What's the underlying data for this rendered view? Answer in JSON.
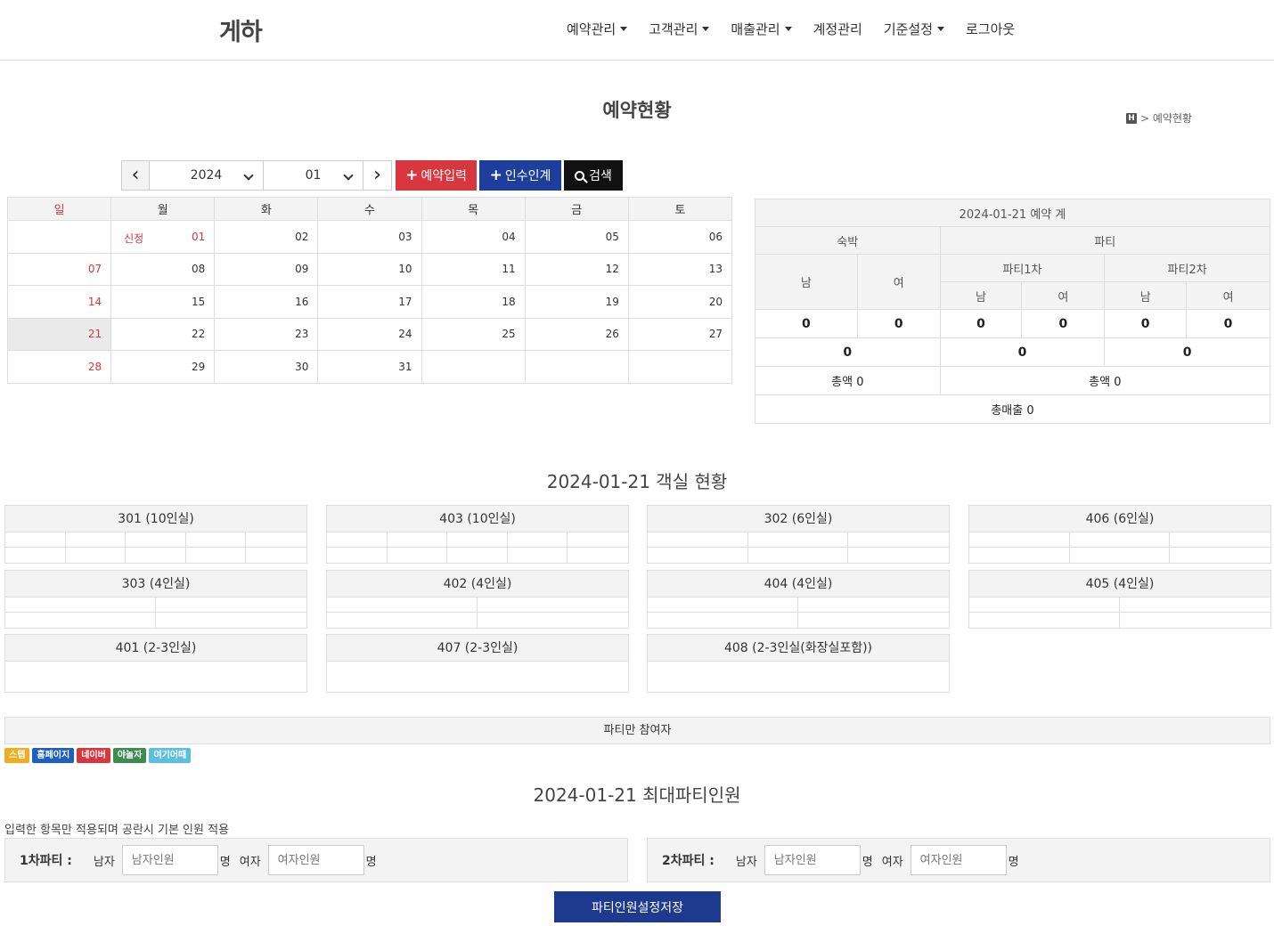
{
  "header": {
    "logo": "게하",
    "nav": [
      {
        "label": "예약관리",
        "dropdown": true
      },
      {
        "label": "고객관리",
        "dropdown": true
      },
      {
        "label": "매출관리",
        "dropdown": true
      },
      {
        "label": "계정관리",
        "dropdown": false
      },
      {
        "label": "기준설정",
        "dropdown": true
      },
      {
        "label": "로그아웃",
        "dropdown": false
      }
    ]
  },
  "page": {
    "title": "예약현황",
    "breadcrumb_home": "H",
    "breadcrumb_sep": ">",
    "breadcrumb_current": "예약현황"
  },
  "controls": {
    "year": "2024",
    "month": "01",
    "prev": "‹",
    "next": "›",
    "add_reservation": "예약입력",
    "handover": "인수인계",
    "search": "검색"
  },
  "calendar": {
    "weekdays": [
      "일",
      "월",
      "화",
      "수",
      "목",
      "금",
      "토"
    ],
    "holiday_label": "신정",
    "weeks": [
      [
        "",
        "01",
        "02",
        "03",
        "04",
        "05",
        "06"
      ],
      [
        "07",
        "08",
        "09",
        "10",
        "11",
        "12",
        "13"
      ],
      [
        "14",
        "15",
        "16",
        "17",
        "18",
        "19",
        "20"
      ],
      [
        "21",
        "22",
        "23",
        "24",
        "25",
        "26",
        "27"
      ],
      [
        "28",
        "29",
        "30",
        "31",
        "",
        "",
        ""
      ]
    ]
  },
  "summary": {
    "title": "2024-01-21 예약 계",
    "stay": "숙박",
    "party": "파티",
    "party1": "파티1차",
    "party2": "파티2차",
    "male": "남",
    "female": "여",
    "stay_m": "0",
    "stay_f": "0",
    "p1_m": "0",
    "p1_f": "0",
    "p2_m": "0",
    "p2_f": "0",
    "stay_total": "0",
    "p1_total": "0",
    "p2_total": "0",
    "stay_amount": "총액 0",
    "party_amount": "총액 0",
    "total_sales": "총매출 0"
  },
  "rooms": {
    "title": "2024-01-21 객실 현황",
    "list": [
      {
        "name": "301 (10인실)"
      },
      {
        "name": "403 (10인실)"
      },
      {
        "name": "302 (6인실)"
      },
      {
        "name": "406 (6인실)"
      },
      {
        "name": "303 (4인실)"
      },
      {
        "name": "402 (4인실)"
      },
      {
        "name": "404 (4인실)"
      },
      {
        "name": "405 (4인실)"
      },
      {
        "name": "401 (2-3인실)"
      },
      {
        "name": "407 (2-3인실)"
      },
      {
        "name": "408 (2-3인실(화장실포함))"
      }
    ]
  },
  "party_only": "파티만 참여자",
  "legend": [
    {
      "label": "스텝",
      "color": "#f0ad1f"
    },
    {
      "label": "홈페이지",
      "color": "#1d5fc4"
    },
    {
      "label": "네이버",
      "color": "#d9373f"
    },
    {
      "label": "야놀자",
      "color": "#3d8b4f"
    },
    {
      "label": "여기어때",
      "color": "#5bc0de"
    }
  ],
  "max_party": {
    "title": "2024-01-21 최대파티인원",
    "note": "입력한 항목만 적용되며 공란시 기본 인원 적용",
    "party1_label": "1차파티 :",
    "party2_label": "2차파티 :",
    "male": "남자",
    "female": "여자",
    "male_placeholder": "남자인원",
    "female_placeholder": "여자인원",
    "unit": "명",
    "save": "파티인원설정저장"
  }
}
